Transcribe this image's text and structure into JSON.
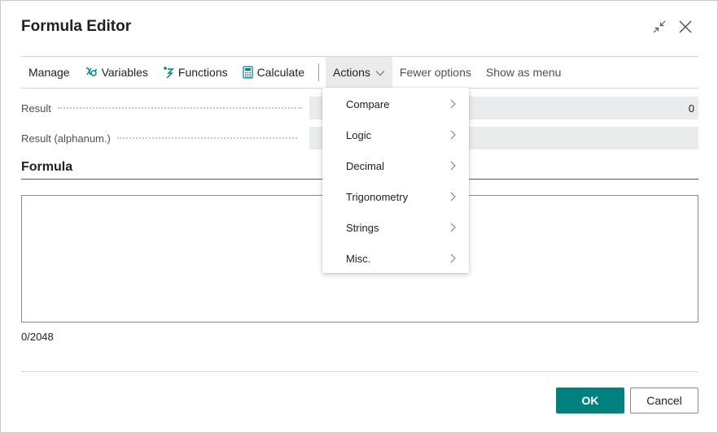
{
  "dialog": {
    "title": "Formula Editor",
    "collapse_icon": "collapse-arrows-icon",
    "close_icon": "close-icon"
  },
  "toolbar": {
    "items": [
      {
        "label": "Manage",
        "icon": null
      },
      {
        "label": "Variables",
        "icon": "variables-icon"
      },
      {
        "label": "Functions",
        "icon": "functions-icon"
      },
      {
        "label": "Calculate",
        "icon": "calculator-icon"
      }
    ],
    "actions_label": "Actions",
    "fewer_options_label": "Fewer options",
    "show_as_menu_label": "Show as menu",
    "accent_color": "#00807f"
  },
  "fields": {
    "result_label": "Result",
    "result_value": "0",
    "result_alpha_label": "Result (alphanum.)",
    "result_alpha_value": ""
  },
  "formula": {
    "section_title": "Formula",
    "value": "",
    "counter": "0/2048"
  },
  "actions_menu": {
    "items": [
      {
        "label": "Compare"
      },
      {
        "label": "Logic"
      },
      {
        "label": "Decimal"
      },
      {
        "label": "Trigonometry"
      },
      {
        "label": "Strings"
      },
      {
        "label": "Misc."
      }
    ]
  },
  "footer": {
    "ok_label": "OK",
    "cancel_label": "Cancel",
    "ok_color": "#00807f"
  }
}
